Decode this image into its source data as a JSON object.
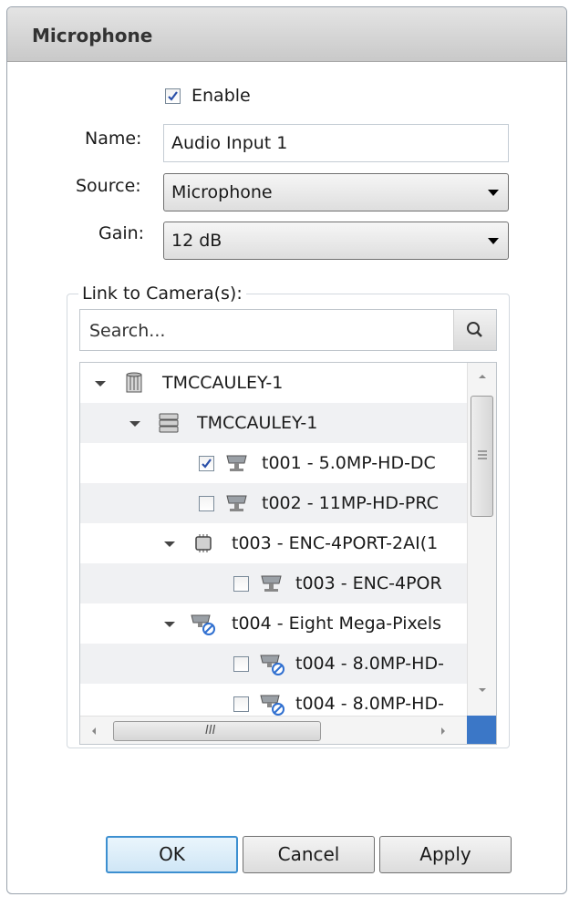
{
  "dialog": {
    "title": "Microphone"
  },
  "form": {
    "enable": {
      "label": "Enable",
      "checked": true
    },
    "name": {
      "label": "Name:",
      "value": "Audio Input 1"
    },
    "source": {
      "label": "Source:",
      "value": "Microphone"
    },
    "gain": {
      "label": "Gain:",
      "value": "12 dB"
    }
  },
  "link_group": {
    "label": "Link to Camera(s):",
    "search_placeholder": "Search...",
    "tree": [
      {
        "text": "TMCCAULEY-1",
        "icon": "server-site-icon",
        "expanded": true
      },
      {
        "text": "TMCCAULEY-1",
        "icon": "server-icon",
        "expanded": true
      },
      {
        "text": "t001 - 5.0MP-HD-DC",
        "icon": "camera-icon",
        "checked": true
      },
      {
        "text": "t002 - 11MP-HD-PRC",
        "icon": "camera-icon",
        "checked": false
      },
      {
        "text": "t003 - ENC-4PORT-2AI(1",
        "icon": "encoder-icon",
        "expanded": true
      },
      {
        "text": "t003 - ENC-4POR",
        "icon": "camera-icon",
        "checked": false
      },
      {
        "text": "t004 - Eight Mega-Pixels",
        "icon": "camera-disconnected-icon",
        "expanded": true
      },
      {
        "text": "t004 - 8.0MP-HD-",
        "icon": "camera-disconnected-icon",
        "checked": false
      },
      {
        "text": "t004 - 8.0MP-HD-",
        "icon": "camera-disconnected-icon",
        "checked": false
      }
    ],
    "hscroll_grip": "III"
  },
  "buttons": {
    "ok": "OK",
    "cancel": "Cancel",
    "apply": "Apply"
  }
}
